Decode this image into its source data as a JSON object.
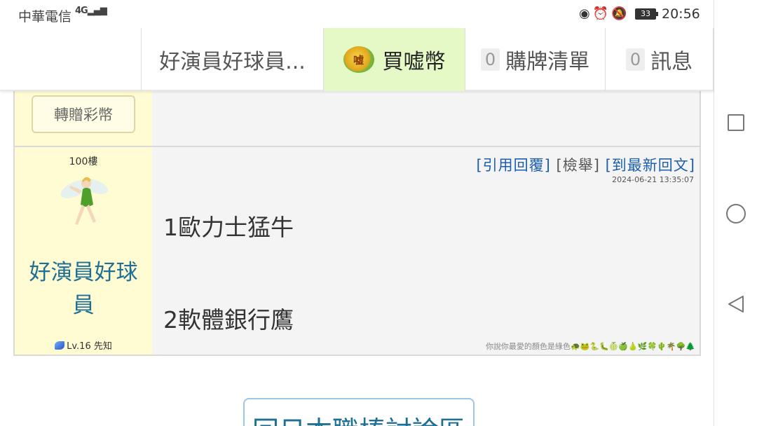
{
  "status_bar": {
    "carrier": "中華電信",
    "network": "4G",
    "battery": "33",
    "time": "20:56"
  },
  "nav": {
    "board": "好演員好球員...",
    "buy_coins": "買嘘幣",
    "coin_icon_text": "嘘",
    "cart_count": "0",
    "cart": "購牌清單",
    "msg_count": "0",
    "messages": "訊息"
  },
  "prev_post": {
    "gift_button": "轉贈彩幣"
  },
  "post": {
    "floor": "100樓",
    "username": "好演員好球員",
    "level": "Lv.16 先知",
    "quote_reply": "[引用回覆]",
    "report": "[檢舉]",
    "latest": "[到最新回文]",
    "timestamp": "2024-06-21 13:35:07",
    "line1": "1歐力士猛牛",
    "line2": "2軟體銀行鷹",
    "signature": "你說你最愛的顏色是綠色"
  },
  "footer": {
    "back_button": "回日本職棒討論區"
  },
  "colors": {
    "highlight_bg": "#e5f9c6",
    "side_bg": "#fffbd3",
    "username": "#1f6f95",
    "link": "#1b5fae"
  }
}
